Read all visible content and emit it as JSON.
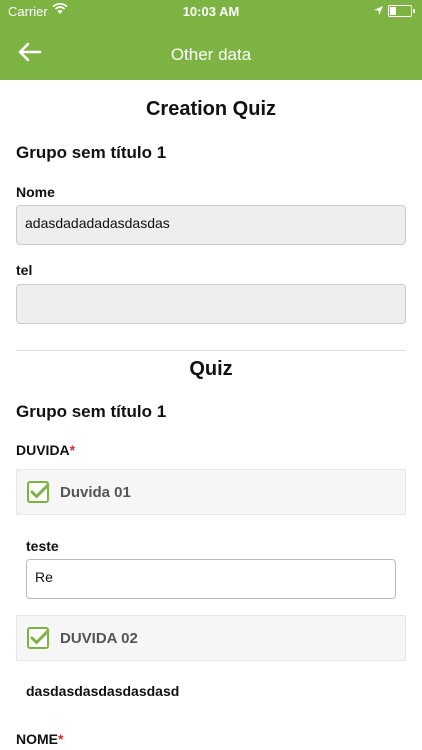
{
  "status": {
    "carrier": "Carrier",
    "time": "10:03 AM"
  },
  "nav": {
    "title": "Other data"
  },
  "creation": {
    "title": "Creation Quiz",
    "group": "Grupo sem título 1",
    "fields": [
      {
        "label": "Nome",
        "value": "adasdadadadasdasdas"
      },
      {
        "label": "tel",
        "value": ""
      }
    ]
  },
  "quiz": {
    "title": "Quiz",
    "group": "Grupo sem título 1",
    "question1": {
      "label": "DUVIDA",
      "required_mark": "*"
    },
    "options": [
      {
        "label": "Duvida 01",
        "sub_label": "teste",
        "sub_value": "Re"
      },
      {
        "label": "DUVIDA 02",
        "sub_text": "dasdasdasdasdasdasd"
      }
    ],
    "question2": {
      "label": "NOME",
      "required_mark": "*"
    }
  },
  "colors": {
    "accent": "#7cb342",
    "required": "#d32f2f"
  }
}
